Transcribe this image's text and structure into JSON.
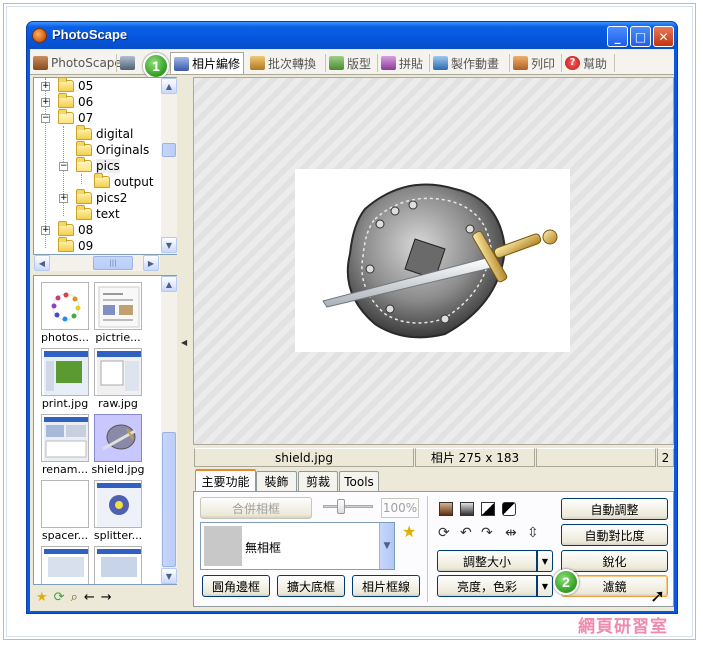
{
  "window": {
    "title": "PhotoScape"
  },
  "tabs": [
    {
      "label": "PhotoScape",
      "icon": "photoscape-icon"
    },
    {
      "label": "",
      "icon": "viewer-icon"
    },
    {
      "label": "相片編修",
      "icon": "editor-icon",
      "active": true
    },
    {
      "label": "批次轉換",
      "icon": "batch-icon"
    },
    {
      "label": "版型",
      "icon": "page-icon"
    },
    {
      "label": "拼貼",
      "icon": "combine-icon"
    },
    {
      "label": "製作動畫",
      "icon": "gif-icon"
    },
    {
      "label": "列印",
      "icon": "print-icon"
    },
    {
      "label": "幫助",
      "icon": "help-icon"
    }
  ],
  "tree": {
    "items": [
      "05",
      "06",
      "07",
      "digital",
      "Originals",
      "pics",
      "output",
      "pics2",
      "text",
      "08",
      "09"
    ]
  },
  "thumbnails": [
    {
      "label": "photos..."
    },
    {
      "label": "pictrie..."
    },
    {
      "label": "print.jpg"
    },
    {
      "label": "raw.jpg"
    },
    {
      "label": "renam..."
    },
    {
      "label": "shield.jpg"
    },
    {
      "label": "spacer..."
    },
    {
      "label": "splitter..."
    }
  ],
  "status": {
    "filename": "shield.jpg",
    "dimensions": "相片 275 x 183",
    "extra": "2"
  },
  "edit_tabs": [
    "主要功能",
    "裝飾",
    "剪裁",
    "Tools"
  ],
  "buttons": {
    "merge_frame": "合併相框",
    "zoom_pct": "100%",
    "frame_none": "無相框",
    "round_corner": "圓角邊框",
    "expand_canvas": "擴大底框",
    "frame_line": "相片框線",
    "auto_level": "自動調整",
    "auto_contrast": "自動對比度",
    "resize": "調整大小",
    "sharpen": "銳化",
    "bright_color": "亮度，色彩",
    "filter": "濾鏡"
  },
  "callouts": [
    "1",
    "2"
  ],
  "watermark": "網頁研習室",
  "bottom_text": "...",
  "colors": {
    "accent": "#0a58e0",
    "callout": "#2f9c1f",
    "active_tab_border": "#e68b2c"
  }
}
